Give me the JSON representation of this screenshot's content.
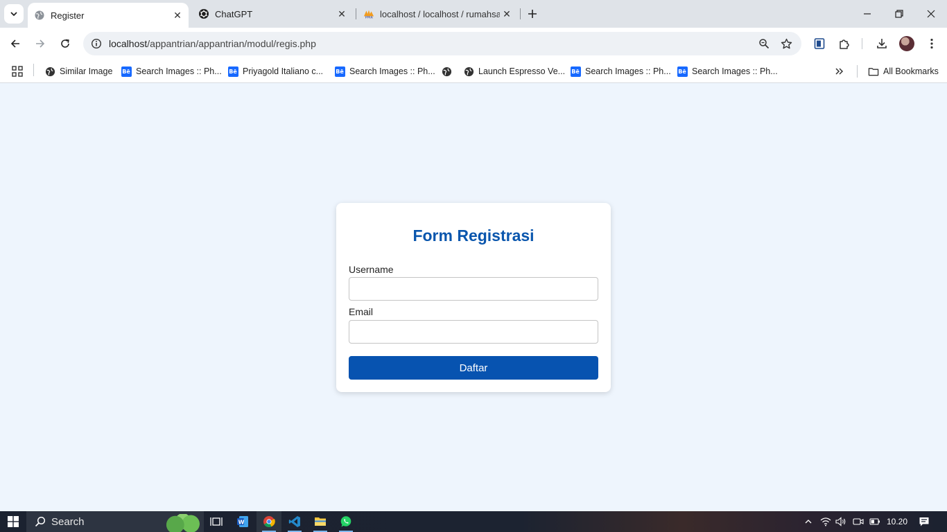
{
  "browser": {
    "tabs": [
      {
        "title": "Register",
        "favicon": "globe-icon",
        "active": true
      },
      {
        "title": "ChatGPT",
        "favicon": "openai-icon",
        "active": false
      },
      {
        "title": "localhost / localhost / rumahsakit",
        "favicon": "phpmyadmin-icon",
        "active": false
      }
    ],
    "url_host": "localhost",
    "url_path": "/appantrian/appantrian/modul/regis.php",
    "bookmarks": [
      {
        "label": "Similar Image",
        "icon": "globe-icon"
      },
      {
        "label": "Search Images :: Ph...",
        "icon": "behance-icon"
      },
      {
        "label": "Priyagold Italiano c...",
        "icon": "behance-icon"
      },
      {
        "label": "Search Images :: Ph...",
        "icon": "behance-icon"
      },
      {
        "label": "",
        "icon": "globe-icon"
      },
      {
        "label": "Launch Espresso Ve...",
        "icon": "globe-icon"
      },
      {
        "label": "Search Images :: Ph...",
        "icon": "behance-icon"
      },
      {
        "label": "Search Images :: Ph...",
        "icon": "behance-icon"
      }
    ],
    "all_bookmarks_label": "All Bookmarks",
    "behance_glyph": "Bē"
  },
  "form": {
    "title": "Form Registrasi",
    "username_label": "Username",
    "username_value": "",
    "email_label": "Email",
    "email_value": "",
    "submit_label": "Daftar"
  },
  "taskbar": {
    "search_label": "Search",
    "time": "10.20"
  },
  "colors": {
    "page_background": "#eef5fd",
    "title_color": "#0a56ad",
    "button_color": "#0753b0"
  }
}
